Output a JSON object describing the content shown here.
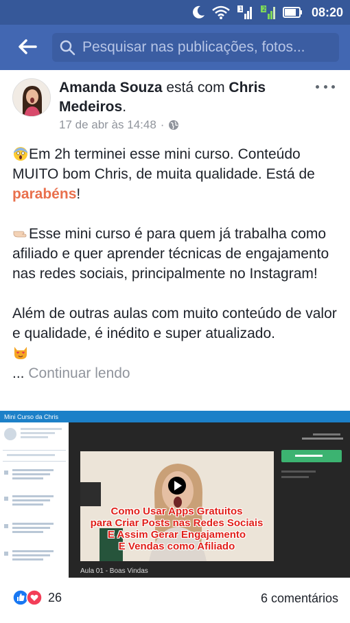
{
  "status_bar": {
    "time": "08:20",
    "sim1": "1",
    "sim2": "2"
  },
  "search": {
    "placeholder": "Pesquisar nas publicações, fotos..."
  },
  "post": {
    "author": "Amanda Souza",
    "connector": "está com",
    "tagged": "Chris Medeiros",
    "timestamp": "17 de abr às 14:48",
    "privacy_separator": "·",
    "paragraph1_pre": "Em 2h terminei esse mini curso. Conteúdo MUITO bom Chris, de muita qualidade. Está de ",
    "paragraph1_hl": "parabéns",
    "paragraph1_post": "!",
    "paragraph2": "Esse mini curso é para quem já trabalha como afiliado e quer aprender técnicas de engajamento nas redes sociais, principalmente no Instagram!",
    "paragraph3": "Além de outras aulas com muito conteúdo de valor e qualidade, é inédito e super atualizado.",
    "ellipsis": "... ",
    "continue_label": "Continuar lendo"
  },
  "video": {
    "course_title": "Mini Curso da Chris",
    "overlay_lines": [
      "Como Usar Apps Gratuitos",
      "para Criar Posts nas Redes Sociais",
      "E Assim Gerar Engajamento",
      "E Vendas como Afiliado"
    ],
    "lesson_caption": "Aula 01 - Boas Vindas"
  },
  "footer": {
    "reaction_count": "26",
    "comments_label": "6 comentários"
  },
  "colors": {
    "status_bar": "#365899",
    "app_bar": "#4267b2",
    "highlight": "#e9704d",
    "video_top": "#1c80c8"
  }
}
